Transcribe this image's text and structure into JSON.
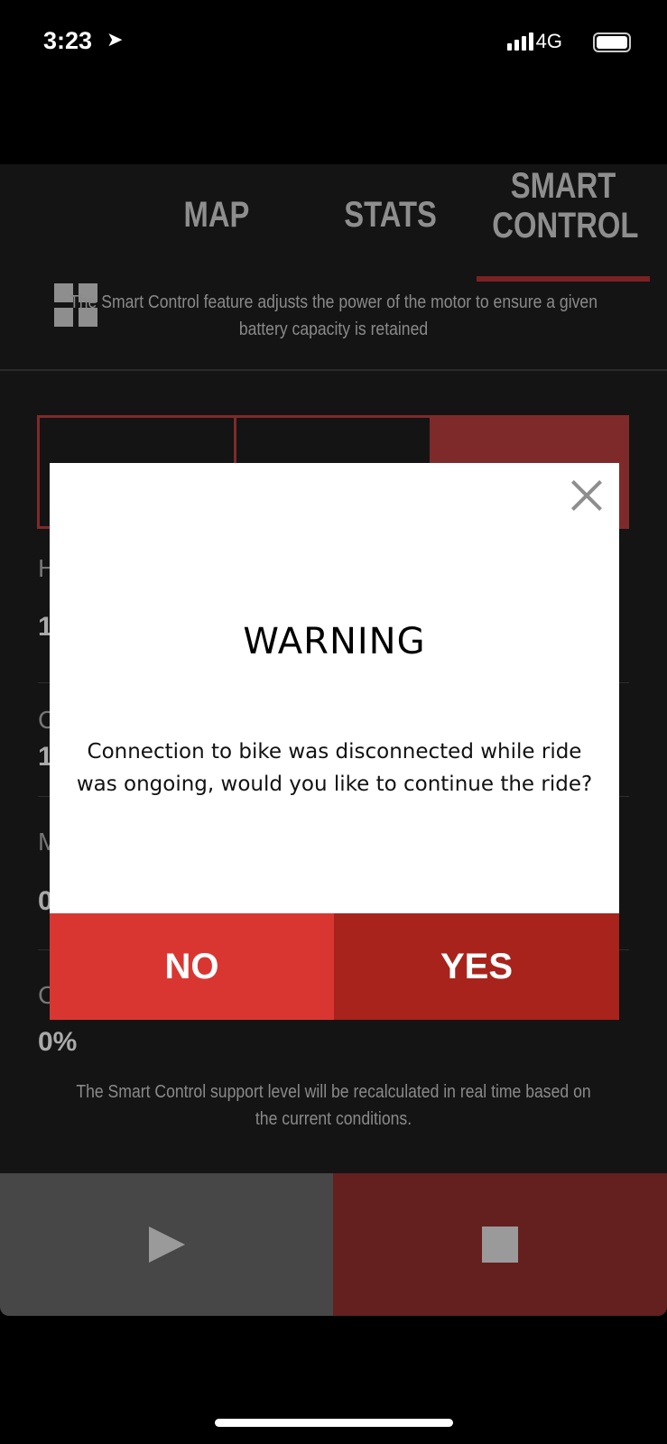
{
  "status_bar": {
    "time": "3:23",
    "network": "4G",
    "icons": [
      "location-arrow-icon",
      "signal-icon",
      "battery-icon"
    ]
  },
  "tabs": {
    "grid_icon": "grid-icon",
    "items": [
      {
        "label": "MAP"
      },
      {
        "label": "STATS"
      },
      {
        "label": "SMART CONTROL",
        "line1": "SMART",
        "line2": "CONTROL",
        "active": true
      }
    ]
  },
  "description": "The Smart Control feature adjusts the power of the motor to ensure a given battery capacity is retained",
  "rows": [
    {
      "label": "H",
      "value": "1"
    },
    {
      "label": "C",
      "value": "1"
    },
    {
      "label": "M",
      "value": "0"
    },
    {
      "label": "C",
      "value": "0%"
    }
  ],
  "footnote": "The Smart Control support level will be recalculated in real time based on the current conditions.",
  "controls": {
    "play_icon": "play-icon",
    "stop_icon": "stop-icon"
  },
  "dialog": {
    "title": "WARNING",
    "message": "Connection to bike was disconnected while ride was ongoing, would you like to continue the ride?",
    "no_label": "NO",
    "yes_label": "YES",
    "close_icon": "close-icon"
  },
  "colors": {
    "accent": "#7f2a2a",
    "no": "#d93632",
    "yes": "#a8231b",
    "stop_bg": "#64201f",
    "play_bg": "#474747"
  }
}
